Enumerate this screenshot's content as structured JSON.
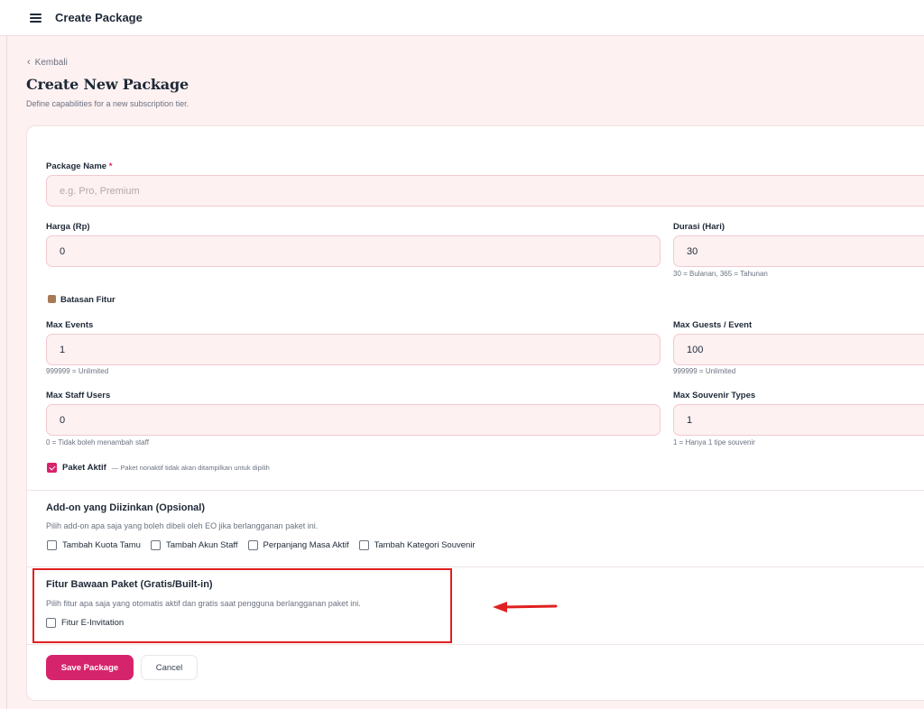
{
  "header": {
    "title": "Create Package",
    "menu_icon": "hamburger-icon"
  },
  "nav": {
    "back_label": "Kembali"
  },
  "page": {
    "title": "Create New Package",
    "subtitle": "Define capabilities for a new subscription tier."
  },
  "form": {
    "package_name": {
      "label": "Package Name",
      "required_mark": "*",
      "placeholder": "e.g. Pro, Premium",
      "value": ""
    },
    "harga": {
      "label": "Harga (Rp)",
      "value": "0"
    },
    "durasi": {
      "label": "Durasi (Hari)",
      "value": "30",
      "hint": "30 = Bulanan, 365 = Tahunan"
    },
    "limits_section": {
      "label": "Batasan Fitur",
      "icon": "box-icon"
    },
    "max_events": {
      "label": "Max Events",
      "value": "1",
      "hint": "999999 = Unlimited"
    },
    "max_guests": {
      "label": "Max Guests / Event",
      "value": "100",
      "hint": "999999 = Unlimited"
    },
    "max_staff": {
      "label": "Max Staff Users",
      "value": "0",
      "hint": "0 = Tidak boleh menambah staff"
    },
    "max_souvenir": {
      "label": "Max Souvenir Types",
      "value": "1",
      "hint": "1 = Hanya 1 tipe souvenir"
    },
    "active": {
      "label": "Paket Aktif",
      "note": "— Paket nonaktif tidak akan ditampilkan untuk dipilih",
      "checked": true
    }
  },
  "addons": {
    "title": "Add-on yang Diizinkan (Opsional)",
    "description": "Pilih add-on apa saja yang boleh dibeli oleh EO jika berlangganan paket ini.",
    "items": [
      {
        "label": "Tambah Kuota Tamu",
        "checked": false
      },
      {
        "label": "Tambah Akun Staff",
        "checked": false
      },
      {
        "label": "Perpanjang Masa Aktif",
        "checked": false
      },
      {
        "label": "Tambah Kategori Souvenir",
        "checked": false
      }
    ]
  },
  "builtin": {
    "title": "Fitur Bawaan Paket (Gratis/Built-in)",
    "description": "Pilih fitur apa saja yang otomatis aktif dan gratis saat pengguna berlangganan paket ini.",
    "items": [
      {
        "label": "Fitur E-Invitation",
        "checked": false
      }
    ]
  },
  "actions": {
    "save_label": "Save Package",
    "cancel_label": "Cancel"
  },
  "colors": {
    "accent": "#d6246c",
    "annotation": "#e02020",
    "input_bg": "#fdf1f2"
  }
}
